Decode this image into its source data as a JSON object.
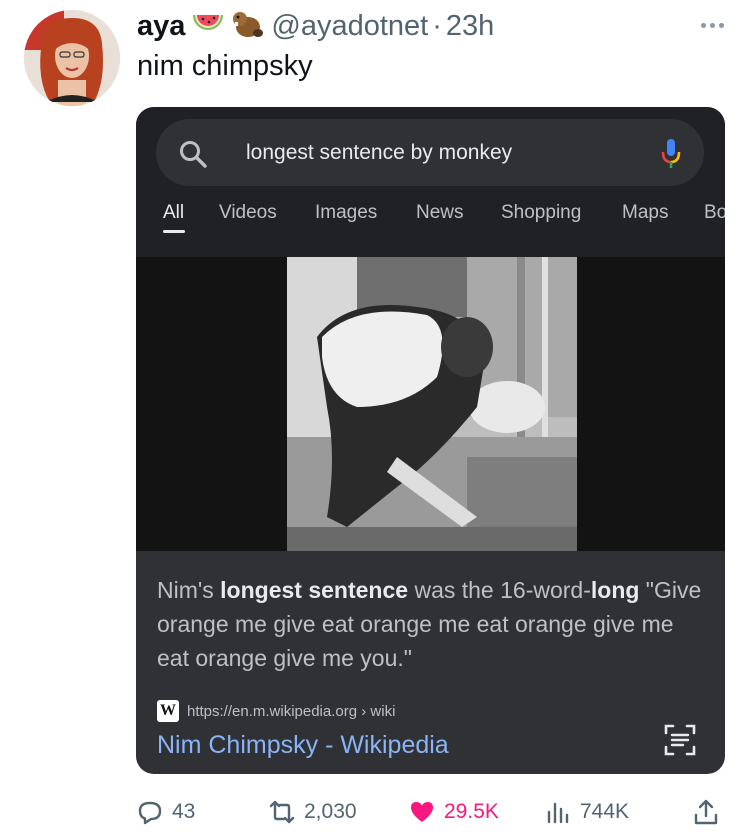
{
  "tweet": {
    "author_name": "aya",
    "author_emojis": [
      "watermelon",
      "beaver"
    ],
    "handle": "@ayadotnet",
    "separator": "·",
    "time": "23h",
    "text": "nim chimpsky"
  },
  "embedded_screenshot": {
    "search_query": "longest sentence by monkey",
    "tabs": [
      "All",
      "Videos",
      "Images",
      "News",
      "Shopping",
      "Maps",
      "Bo"
    ],
    "active_tab": "All",
    "snippet": {
      "part1": "Nim's ",
      "bold1": "longest sentence",
      "part2": " was the 16-word-",
      "bold2": "long",
      "part3": " \"Give orange me give eat orange me eat orange give me eat orange give me you.\""
    },
    "source_url": "https://en.m.wikipedia.org › wiki",
    "source_icon_letter": "W",
    "result_title": "Nim Chimpsky - Wikipedia",
    "colors": {
      "card_bg": "#303134",
      "link": "#8ab4f8"
    }
  },
  "actions": {
    "replies": "43",
    "retweets": "2,030",
    "likes": "29.5K",
    "views": "744K"
  },
  "colors": {
    "like": "#f91880",
    "muted": "#536471"
  }
}
